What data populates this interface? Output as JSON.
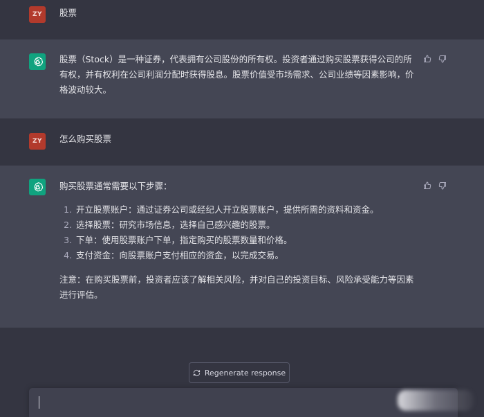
{
  "messages": [
    {
      "role": "user",
      "avatar": "ZY",
      "text": "股票"
    },
    {
      "role": "assistant",
      "avatar_icon": "openai-logo-icon",
      "paragraphs": [
        "股票（Stock）是一种证券，代表拥有公司股份的所有权。投资者通过购买股票获得公司的所有权，并有权利在公司利润分配时获得股息。股票价值受市场需求、公司业绩等因素影响，价格波动较大。"
      ]
    },
    {
      "role": "user",
      "avatar": "ZY",
      "text": "怎么购买股票"
    },
    {
      "role": "assistant",
      "avatar_icon": "openai-logo-icon",
      "intro": "购买股票通常需要以下步骤：",
      "steps": [
        "开立股票账户：通过证券公司或经纪人开立股票账户，提供所需的资料和资金。",
        "选择股票：研究市场信息，选择自己感兴趣的股票。",
        "下单：使用股票账户下单，指定购买的股票数量和价格。",
        "支付资金：向股票账户支付相应的资金，以完成交易。"
      ],
      "note": "注意：在购买股票前，投资者应该了解相关风险，并对自己的投资目标、风险承受能力等因素进行评估。"
    }
  ],
  "regenerate_label": "Regenerate response",
  "composer": {
    "value": "",
    "placeholder": ""
  },
  "icons": {
    "thumbs_up": "thumbs-up-icon",
    "thumbs_down": "thumbs-down-icon",
    "regenerate": "refresh-icon"
  },
  "colors": {
    "background": "#343541",
    "assistant_bg": "#444654",
    "user_avatar": "#b23a2c",
    "gpt_avatar": "#10a37f"
  }
}
